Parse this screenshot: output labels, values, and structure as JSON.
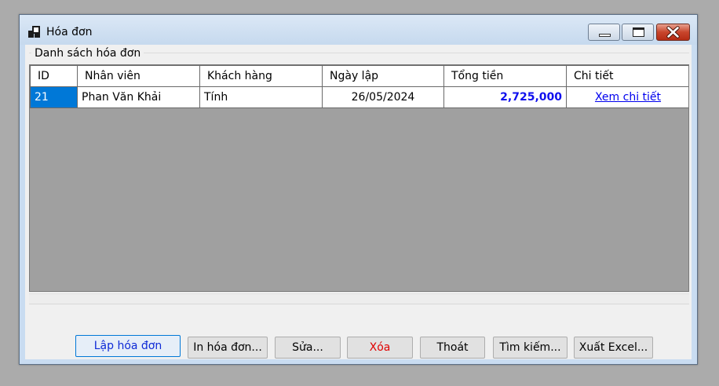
{
  "window": {
    "title": "Hóa đơn"
  },
  "group": {
    "label": "Danh sách hóa đơn"
  },
  "table": {
    "columns": [
      "ID",
      "Nhân viên",
      "Khách hàng",
      "Ngày lập",
      "Tổng tiền",
      "Chi tiết"
    ],
    "rows": [
      {
        "id": "21",
        "nhan_vien": "Phan Văn Khải",
        "khach_hang": "Tính",
        "ngay_lap": "26/05/2024",
        "tong_tien": "2,725,000",
        "chi_tiet": "Xem chi tiết"
      }
    ]
  },
  "buttons": {
    "lap_hoa_don": "Lập hóa đơn",
    "in_hoa_don": "In hóa đơn...",
    "sua": "Sửa...",
    "xoa": "Xóa",
    "thoat": "Thoát",
    "tim_kiem": "Tìm kiếm...",
    "xuat_excel": "Xuất Excel..."
  },
  "colors": {
    "selection": "#0078d7",
    "amount": "#1010ee",
    "delete_text": "#e00000",
    "link": "#0000ee"
  },
  "icons": {
    "app": "window-app-icon",
    "minimize": "minimize-icon",
    "maximize": "maximize-icon",
    "close": "close-icon"
  }
}
